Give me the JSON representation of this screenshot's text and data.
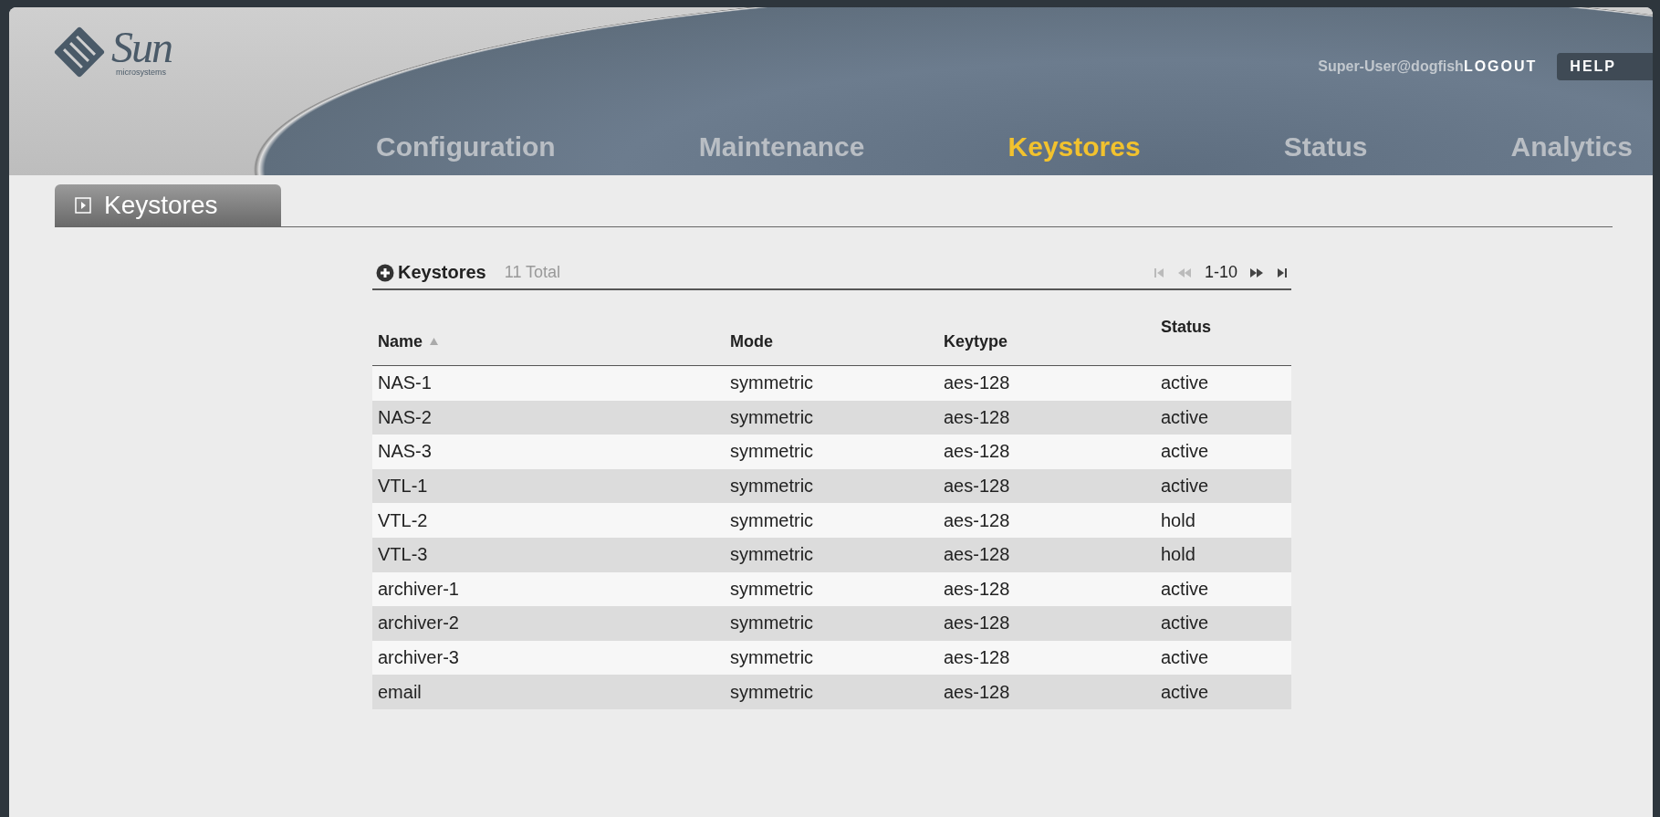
{
  "logo": {
    "wordmark": "Sun",
    "subtitle": "microsystems"
  },
  "user": {
    "name": "Super-User@dogfish",
    "logout": "LOGOUT",
    "help": "HELP"
  },
  "nav": [
    {
      "label": "Configuration",
      "selected": false
    },
    {
      "label": "Maintenance",
      "selected": false
    },
    {
      "label": "Keystores",
      "selected": true
    },
    {
      "label": "Status",
      "selected": false
    },
    {
      "label": "Analytics",
      "selected": false
    }
  ],
  "page_tab": {
    "label": "Keystores"
  },
  "table": {
    "title": "Keystores",
    "total": "11 Total",
    "pager": {
      "range": "1-10",
      "first_disabled": true,
      "prev_disabled": true,
      "next_disabled": false,
      "last_disabled": false
    },
    "columns": [
      {
        "label": "Name",
        "sorted": true
      },
      {
        "label": "Mode",
        "sorted": false
      },
      {
        "label": "Keytype",
        "sorted": false
      },
      {
        "label": "Status",
        "sorted": false
      }
    ],
    "rows": [
      [
        "NAS-1",
        "symmetric",
        "aes-128",
        "active"
      ],
      [
        "NAS-2",
        "symmetric",
        "aes-128",
        "active"
      ],
      [
        "NAS-3",
        "symmetric",
        "aes-128",
        "active"
      ],
      [
        "VTL-1",
        "symmetric",
        "aes-128",
        "active"
      ],
      [
        "VTL-2",
        "symmetric",
        "aes-128",
        "hold"
      ],
      [
        "VTL-3",
        "symmetric",
        "aes-128",
        "hold"
      ],
      [
        "archiver-1",
        "symmetric",
        "aes-128",
        "active"
      ],
      [
        "archiver-2",
        "symmetric",
        "aes-128",
        "active"
      ],
      [
        "archiver-3",
        "symmetric",
        "aes-128",
        "active"
      ],
      [
        "email",
        "symmetric",
        "aes-128",
        "active"
      ]
    ]
  }
}
